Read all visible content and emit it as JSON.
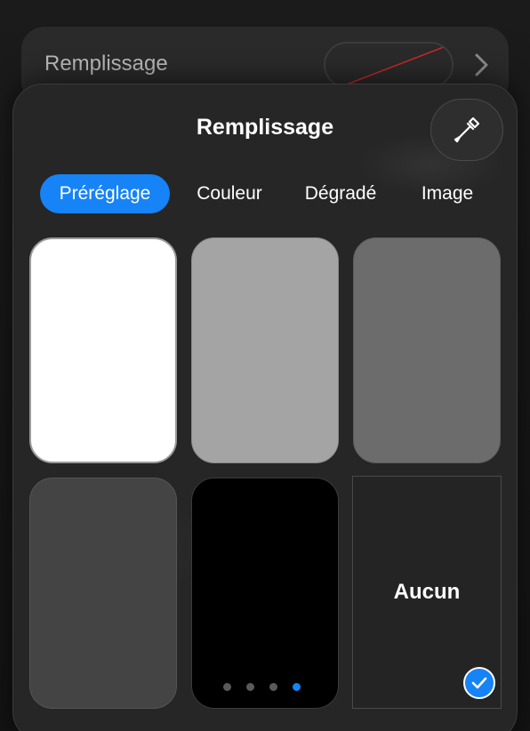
{
  "background_row": {
    "label": "Remplissage"
  },
  "popover": {
    "title": "Remplissage",
    "tabs": [
      {
        "label": "Préréglage",
        "active": true
      },
      {
        "label": "Couleur",
        "active": false
      },
      {
        "label": "Dégradé",
        "active": false
      },
      {
        "label": "Image",
        "active": false
      }
    ],
    "swatches": [
      {
        "color": "#ffffff"
      },
      {
        "color": "#a4a4a4"
      },
      {
        "color": "#6c6c6c"
      },
      {
        "color": "#444444"
      },
      {
        "color": "#000000"
      }
    ],
    "none_option": {
      "label": "Aucun",
      "selected": true
    },
    "pagination": {
      "page_count": 4,
      "current_page": 4
    }
  },
  "colors": {
    "accent": "#1683f7",
    "panel": "#262626",
    "swatch_indicator_line": "#c62828"
  },
  "icons": {
    "eyedropper": "eyedropper-icon",
    "chevron": "chevron-right-icon",
    "check": "checkmark-icon"
  }
}
